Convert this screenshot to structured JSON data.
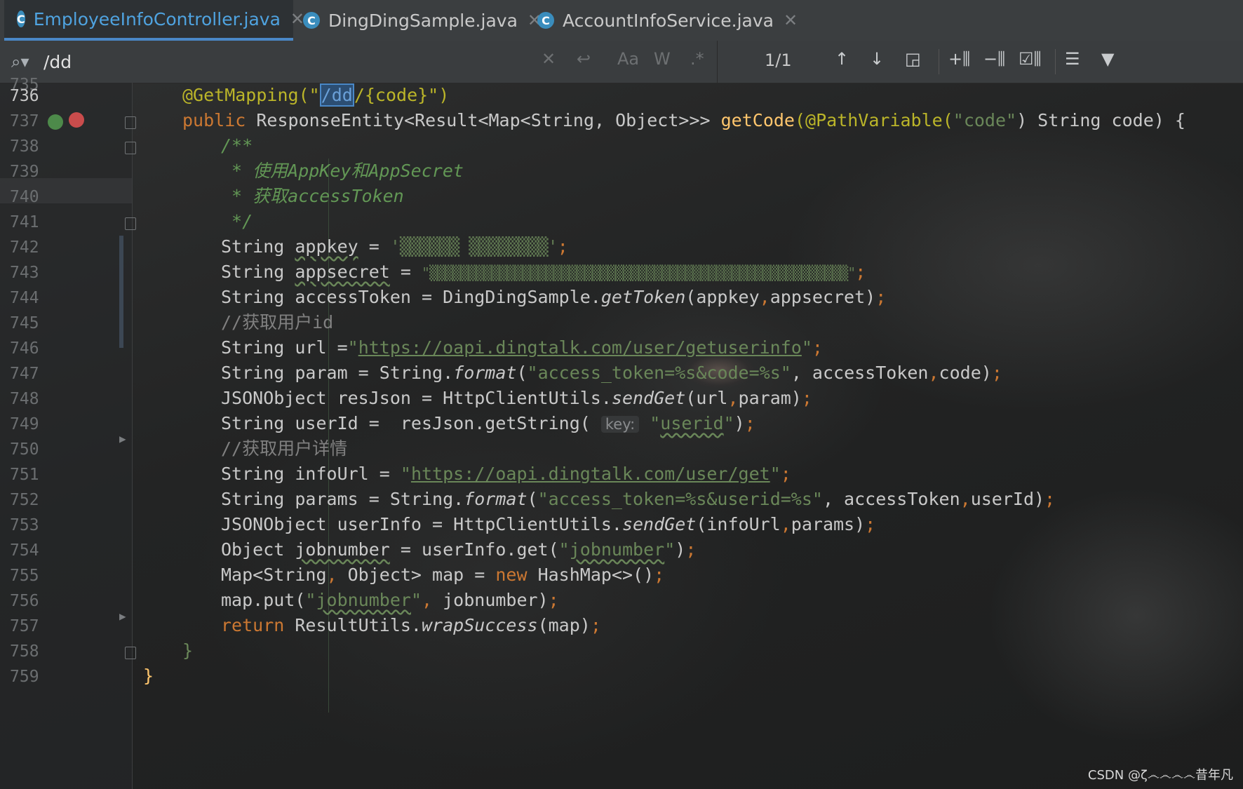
{
  "tabs": [
    {
      "label": "EmployeeInfoController.java",
      "icon": "C",
      "active": true
    },
    {
      "label": "DingDingSample.java",
      "icon": "C",
      "active": false
    },
    {
      "label": "AccountInfoService.java",
      "icon": "C",
      "active": false
    }
  ],
  "search": {
    "query": "/dd",
    "match_count": "1/1",
    "match_case_label": "Aa",
    "words_label": "W",
    "regex_label": ".*"
  },
  "gutter": {
    "line_numbers": [
      "736",
      "737",
      "738",
      "739",
      "740",
      "741",
      "742",
      "743",
      "744",
      "745",
      "746",
      "747",
      "748",
      "749",
      "750",
      "751",
      "752",
      "753",
      "754",
      "755",
      "756",
      "757",
      "758",
      "759"
    ],
    "current_line": "736",
    "prev_line_partial": "735"
  },
  "code": {
    "l736": {
      "a": "@GetMapping(\"",
      "m": "/dd",
      "b": "/{code}\")"
    },
    "l737": {
      "kw": "public",
      "rest1": " ResponseEntity<Result<Map<String, Object>>> ",
      "fn": "getCode",
      "ann": "(@PathVariable(",
      "str": "\"code\"",
      "rest2": ") String code) {"
    },
    "l738": "/**",
    "l739": " * 使用AppKey和AppSecret",
    "l740": " * 获取accessToken",
    "l741": " */",
    "l742": {
      "a": "String ",
      "v": "appkey",
      "b": " = ",
      "s": "'▒▒▒▒▒▒ ▒▒▒▒▒▒▒▒'",
      "e": ";"
    },
    "l743": {
      "a": "String ",
      "v": "appsecret",
      "b": " = ",
      "s": "\"▒▒▒▒▒▒▒▒▒▒▒▒▒▒▒▒▒▒▒▒▒▒▒▒▒▒▒▒▒▒▒▒▒▒▒▒▒▒▒▒▒▒▒▒▒▒▒▒▒▒▒▒▒▒\"",
      "e": ";"
    },
    "l744": {
      "a": "String accessToken = DingDingSample.",
      "it": "getToken",
      "b": "(appkey",
      "c": ",",
      "d": "appsecret)",
      "e": ";"
    },
    "l745": "//获取用户id",
    "l746": {
      "a": "String url =",
      "q1": "\"",
      "u": "https://oapi.dingtalk.com/user/getuserinfo",
      "q2": "\"",
      "e": ";"
    },
    "l747": {
      "a": "String param = String.",
      "it": "format",
      "b": "(",
      "s": "\"access_token=%s&code=%s\"",
      "c": ", accessToken",
      "d": ",",
      "f": "code)",
      "e": ";"
    },
    "l748": {
      "a": "JSONObject resJson = HttpClientUtils.",
      "it": "sendGet",
      "b": "(url",
      "c": ",",
      "d": "param)",
      "e": ";"
    },
    "l749": {
      "a": "String userId =  resJson.getString( ",
      "hint": "key:",
      "s1": " \"",
      "v": "userid",
      "s2": "\"",
      "b": ")",
      "e": ";"
    },
    "l750": "//获取用户详情",
    "l751": {
      "a": "String infoUrl = ",
      "q1": "\"",
      "u": "https://oapi.dingtalk.com/user/get",
      "q2": "\"",
      "e": ";"
    },
    "l752": {
      "a": "String params = String.",
      "it": "format",
      "b": "(",
      "s": "\"access_token=%s&userid=%s\"",
      "c": ", accessToken",
      "d": ",",
      "f": "userId)",
      "e": ";"
    },
    "l753": {
      "a": "JSONObject userInfo = HttpClientUtils.",
      "it": "sendGet",
      "b": "(infoUrl",
      "c": ",",
      "d": "params)",
      "e": ";"
    },
    "l754": {
      "a": "Object ",
      "v": "jobnumber",
      "b": " = userInfo.get(",
      "s1": "\"",
      "sv": "jobnumber",
      "s2": "\"",
      "c": ")",
      "e": ";"
    },
    "l755": {
      "a": "Map<String",
      "c": ",",
      "b": " Object> map = ",
      "kw": "new",
      "d": " HashMap<>()",
      "e": ";"
    },
    "l756": {
      "a": "map.put(",
      "s1": "\"",
      "sv": "jobnumber",
      "s2": "\"",
      "c": ",",
      "b": " jobnumber)",
      "e": ";"
    },
    "l757": {
      "kw": "return",
      "a": " ResultUtils.",
      "it": "wrapSuccess",
      "b": "(map)",
      "e": ";"
    },
    "l758": "}",
    "l759": "}"
  },
  "watermark": "CSDN @ζ෴෴෴෴昔年凡",
  "colors": {
    "keyword": "#cc7832",
    "string": "#6a8759",
    "annotation": "#bbb529",
    "comment": "#808080",
    "doc_comment": "#629755",
    "function": "#ffc66d",
    "active_tab": "#4fa3e0"
  }
}
